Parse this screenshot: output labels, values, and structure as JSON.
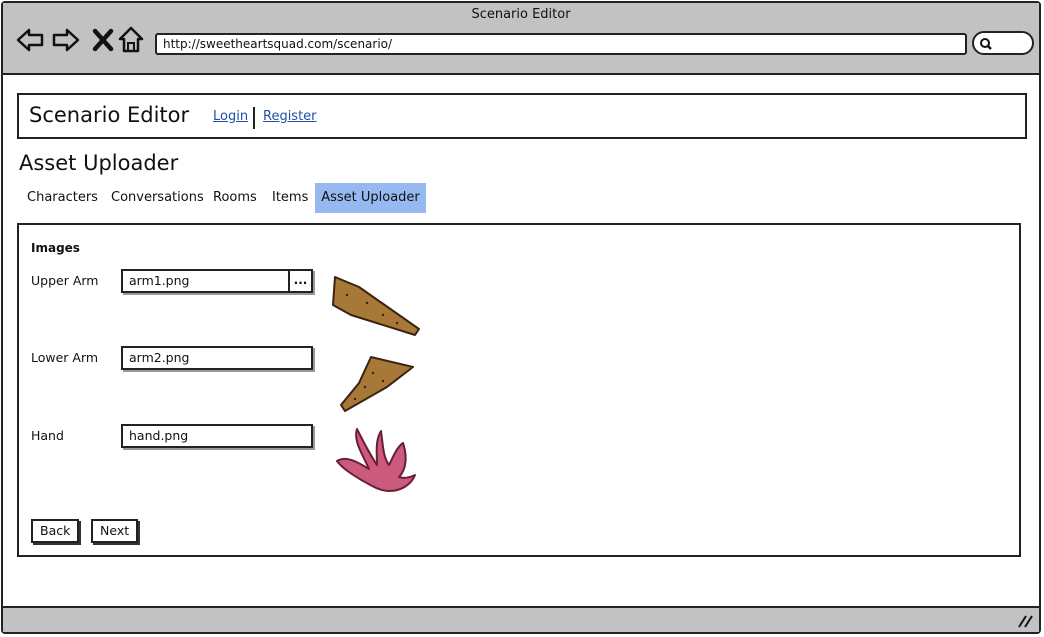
{
  "browser": {
    "window_title": "Scenario Editor",
    "url": "http://sweetheartsquad.com/scenario/"
  },
  "header": {
    "app_title": "Scenario Editor",
    "login": "Login",
    "register": "Register"
  },
  "page": {
    "title": "Asset Uploader"
  },
  "tabs": [
    {
      "label": "Characters"
    },
    {
      "label": "Conversations"
    },
    {
      "label": "Rooms"
    },
    {
      "label": "Items"
    },
    {
      "label": "Asset Uploader",
      "active": true
    }
  ],
  "images_section": {
    "label": "Images",
    "fields": [
      {
        "label": "Upper Arm",
        "value": "arm1.png",
        "browse_label": "..."
      },
      {
        "label": "Lower Arm",
        "value": "arm2.png"
      },
      {
        "label": "Hand",
        "value": "hand.png"
      }
    ]
  },
  "buttons": {
    "back": "Back",
    "next": "Next"
  },
  "colors": {
    "active_tab": "#97b9f2",
    "chrome": "#c2c2c2",
    "link": "#1f4fa8",
    "arm": "#a87838",
    "hand": "#cc5a7c"
  }
}
